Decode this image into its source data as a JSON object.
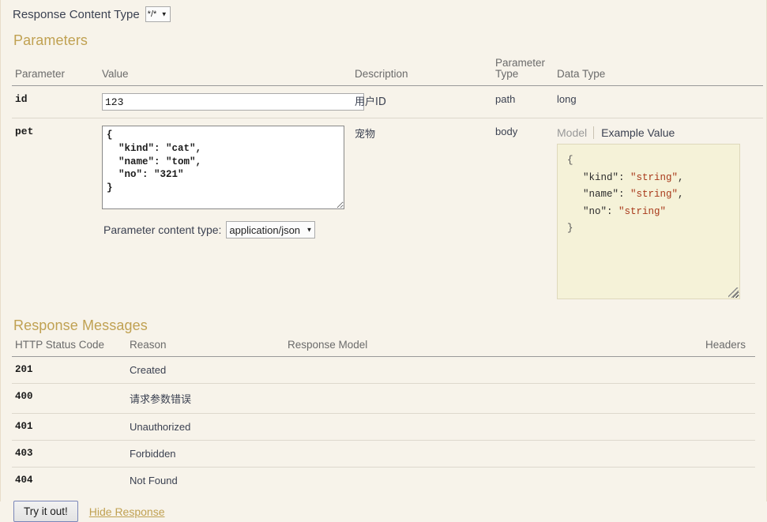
{
  "response_content_type": {
    "label": "Response Content Type",
    "selected": "*/*",
    "options": [
      "*/*"
    ]
  },
  "parameters_section": {
    "title": "Parameters",
    "headers": {
      "parameter": "Parameter",
      "value": "Value",
      "description": "Description",
      "parameter_type": "Parameter\nType",
      "parameter_type_line1": "Parameter",
      "parameter_type_line2": "Type",
      "data_type": "Data Type"
    },
    "rows": [
      {
        "parameter": "id",
        "value": "123",
        "description": "用户ID",
        "parameter_type": "path",
        "data_type": "long"
      },
      {
        "parameter": "pet",
        "value": "{\n  \"kind\": \"cat\",\n  \"name\": \"tom\",\n  \"no\": \"321\"\n}",
        "description": "宠物",
        "parameter_type": "body",
        "data_type": ""
      }
    ],
    "content_type": {
      "label": "Parameter content type:",
      "selected": "application/json",
      "options": [
        "application/json"
      ]
    },
    "model_tabs": {
      "model": "Model",
      "example_value": "Example Value",
      "active": "Example Value"
    },
    "example_value": {
      "open_brace": "{",
      "lines": [
        {
          "key": "\"kind\"",
          "sep": ": ",
          "value": "\"string\"",
          "comma": ","
        },
        {
          "key": "\"name\"",
          "sep": ": ",
          "value": "\"string\"",
          "comma": ","
        },
        {
          "key": "\"no\"",
          "sep": ": ",
          "value": "\"string\"",
          "comma": ""
        }
      ],
      "close_brace": "}"
    }
  },
  "response_messages_section": {
    "title": "Response Messages",
    "headers": {
      "http_status_code": "HTTP Status Code",
      "reason": "Reason",
      "response_model": "Response Model",
      "headers": "Headers"
    },
    "rows": [
      {
        "code": "201",
        "reason": "Created",
        "response_model": "",
        "headers": ""
      },
      {
        "code": "400",
        "reason": "请求参数错误",
        "response_model": "",
        "headers": ""
      },
      {
        "code": "401",
        "reason": "Unauthorized",
        "response_model": "",
        "headers": ""
      },
      {
        "code": "403",
        "reason": "Forbidden",
        "response_model": "",
        "headers": ""
      },
      {
        "code": "404",
        "reason": "Not Found",
        "response_model": "",
        "headers": ""
      }
    ]
  },
  "footer": {
    "try_it_out": "Try it out!",
    "hide_response": "Hide Response"
  },
  "colors": {
    "background": "#f7f3ea",
    "section_title": "#c0a152",
    "example_box_bg": "#f5f2d8",
    "example_string": "#a8391a",
    "link": "#c0a152"
  }
}
